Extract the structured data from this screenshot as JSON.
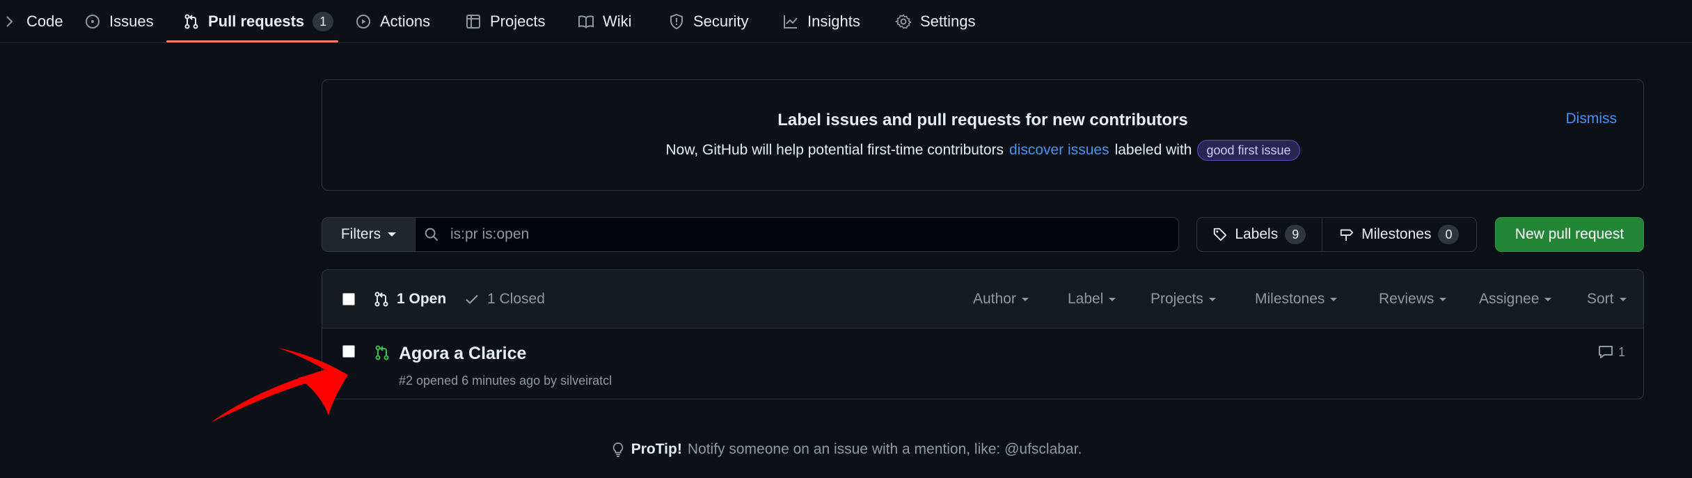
{
  "nav": {
    "tabs": [
      {
        "label": "Code",
        "icon": "chevron-right-icon"
      },
      {
        "label": "Issues",
        "icon": "issue-circle-icon"
      },
      {
        "label": "Pull requests",
        "icon": "git-pull-request-icon",
        "count": "1",
        "selected": true
      },
      {
        "label": "Actions",
        "icon": "play-circle-icon"
      },
      {
        "label": "Projects",
        "icon": "table-icon"
      },
      {
        "label": "Wiki",
        "icon": "book-icon"
      },
      {
        "label": "Security",
        "icon": "shield-icon"
      },
      {
        "label": "Insights",
        "icon": "graph-icon"
      },
      {
        "label": "Settings",
        "icon": "gear-icon"
      }
    ],
    "selected_underline_color": "#f78166"
  },
  "banner": {
    "title": "Label issues and pull requests for new contributors",
    "text_before": "Now, GitHub will help potential first-time contributors",
    "link_text": "discover issues",
    "text_after": "labeled with",
    "label_pill": "good first issue",
    "dismiss": "Dismiss"
  },
  "filter_bar": {
    "filters_label": "Filters",
    "search_value": "is:pr is:open",
    "labels_label": "Labels",
    "labels_count": "9",
    "milestones_label": "Milestones",
    "milestones_count": "0",
    "new_pr_label": "New pull request"
  },
  "list": {
    "open_label": "1 Open",
    "closed_label": "1 Closed",
    "dropdowns": [
      "Author",
      "Label",
      "Projects",
      "Milestones",
      "Reviews",
      "Assignee",
      "Sort"
    ],
    "items": [
      {
        "title": "Agora a Clarice",
        "meta": "#2 opened 6 minutes ago by silveiratcl",
        "comments": "1"
      }
    ]
  },
  "protip": {
    "bold": "ProTip!",
    "text": "Notify someone on an issue with a mention, like: @ufsclabar."
  },
  "colors": {
    "background": "#0d1117",
    "accent_link": "#4493f8",
    "open_green": "#3fb950",
    "primary_button": "#238636",
    "annotation_arrow": "#ff0000"
  }
}
